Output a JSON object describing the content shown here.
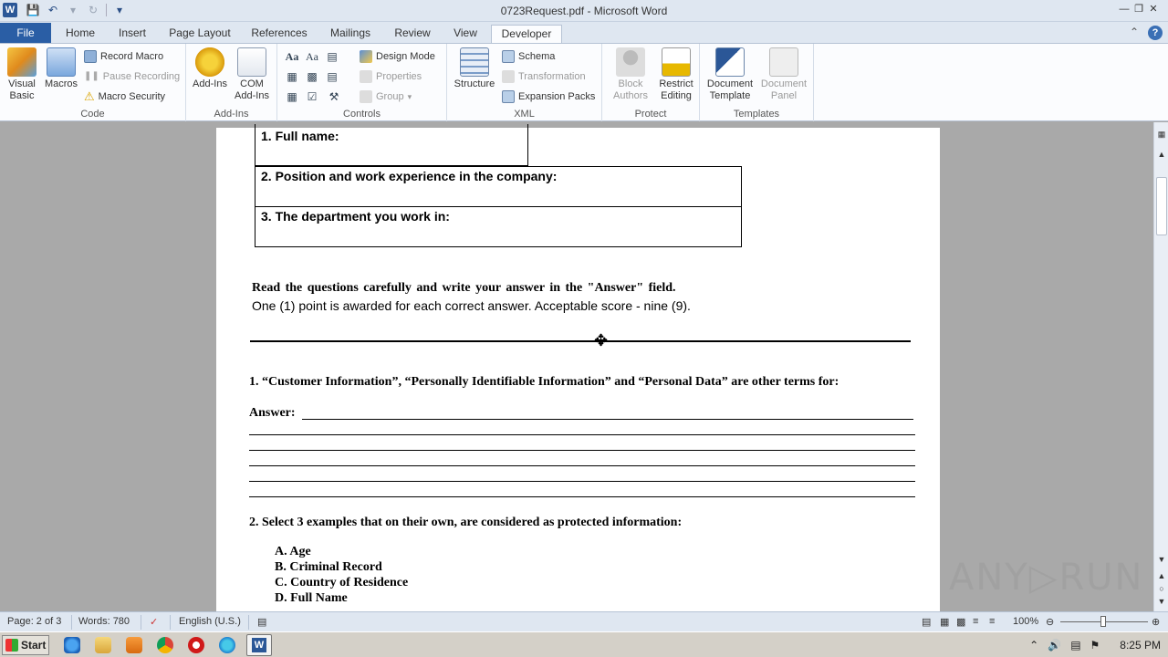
{
  "window": {
    "title": "0723Request.pdf - Microsoft Word",
    "app_icon": "word-logo-icon"
  },
  "tabs": [
    {
      "label": "File"
    },
    {
      "label": "Home"
    },
    {
      "label": "Insert"
    },
    {
      "label": "Page Layout"
    },
    {
      "label": "References"
    },
    {
      "label": "Mailings"
    },
    {
      "label": "Review"
    },
    {
      "label": "View"
    },
    {
      "label": "Developer",
      "active": true
    }
  ],
  "ribbon": {
    "code": {
      "label": "Code",
      "visual_basic": "Visual Basic",
      "macros": "Macros",
      "record_macro": "Record Macro",
      "pause_recording": "Pause Recording",
      "macro_security": "Macro Security"
    },
    "addins": {
      "label": "Add-Ins",
      "add_ins": "Add-Ins",
      "com_add_ins": "COM Add-Ins"
    },
    "controls": {
      "label": "Controls",
      "design_mode": "Design Mode",
      "properties": "Properties",
      "group": "Group"
    },
    "xml": {
      "label": "XML",
      "structure": "Structure",
      "schema": "Schema",
      "transformation": "Transformation",
      "expansion_packs": "Expansion Packs"
    },
    "protect": {
      "label": "Protect",
      "block_authors": "Block Authors",
      "restrict_editing": "Restrict Editing"
    },
    "templates": {
      "label": "Templates",
      "document_template": "Document Template",
      "document_panel": "Document Panel"
    }
  },
  "document": {
    "form": {
      "full_name": "1. Full name:",
      "position": "2. Position and work experience in the company:",
      "department": "3. The department you work in:"
    },
    "instructions": {
      "line1": "Read the questions carefully and write your answer in the \"Answer\" field.",
      "line2": "One (1) point is awarded for each correct answer. Acceptable score - nine (9)."
    },
    "q1": {
      "text": "1. “Customer Information”, “Personally Identifiable Information” and “Personal Data” are other terms for:",
      "answer_label": "Answer:"
    },
    "q2": {
      "text": "2. Select 3 examples that on their own, are considered as protected information:",
      "options": [
        "A.  Age",
        "B.  Criminal Record",
        "C.  Country of Residence",
        "D.  Full Name"
      ]
    }
  },
  "status": {
    "page": "Page: 2 of 3",
    "words": "Words: 780",
    "language": "English (U.S.)",
    "zoom": "100%",
    "zoom_level": 1.0
  },
  "taskbar": {
    "start": "Start",
    "clock": "8:25 PM"
  },
  "watermark": "ANY▷RUN",
  "colors": {
    "file_tab": "#2a5ea5",
    "ribbon_bg": "#fbfcfe",
    "chrome_bg": "#dfe7f1"
  }
}
